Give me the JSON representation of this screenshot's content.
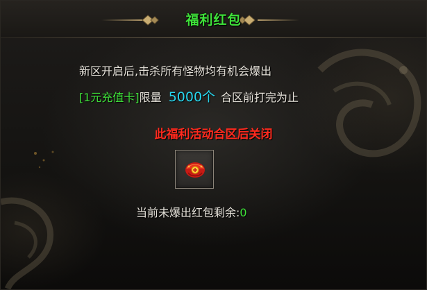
{
  "title": "福利红包",
  "description": "新区开启后,击杀所有怪物均有机会爆出",
  "limit_line": {
    "card_name": "[1元充值卡]",
    "limit_label": "限量",
    "quantity": "5000个",
    "suffix": "合区前打完为止"
  },
  "warning": "此福利活动合区后关闭",
  "reward_item": {
    "icon": "red-envelope-icon"
  },
  "remaining": {
    "label": "当前未爆出红包剩余:",
    "value": "0"
  },
  "colors": {
    "title": "#3fe23a",
    "text": "#e6e2da",
    "highlight_green": "#3fe23a",
    "highlight_cyan": "#27d6ee",
    "warning": "#ff2a1e"
  }
}
